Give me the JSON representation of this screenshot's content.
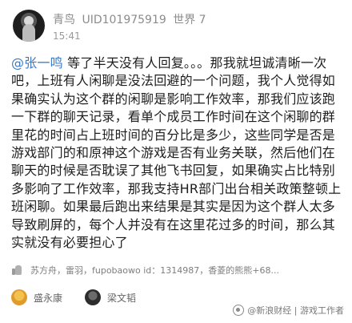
{
  "header": {
    "username": "青鸟",
    "uid": "UID101975919",
    "world": "世界 7",
    "time": "15:41"
  },
  "message": {
    "mention": "@张一鸣",
    "text": " 等了半天没有人回复。。。那我就坦诚清晰一次吧，上班有人闲聊是没法回避的一个问题，我个人觉得如果确实认为这个群的闲聊是影响工作效率，那我们应该跑一下群的聊天记录，看单个成员工作时间在这个闲聊的群里花的时间占上班时间的百分比是多少，这些同学是否是游戏部门的和原神这个游戏是否有业务关联，然后他们在聊天的时候是否耽误了其他飞书回复，如果确实占比特别多影响了工作效率，那我支持HR部门出台相关政策整顿上班闲聊。如果最后跑出来结果是其实是因为这个群人太多导致刷屏的，每个人并没有在这里花过多的时间，那么其实就没有必要担心了"
  },
  "likes": {
    "text": "苏方舟，雷羽，fupobaowo id：1314987，香菱的熊熊+68..."
  },
  "reactors": [
    {
      "name": "盛永康"
    },
    {
      "name": "梁文韬"
    }
  ],
  "watermark": {
    "text": "@新浪财经 | 游戏工作者"
  }
}
